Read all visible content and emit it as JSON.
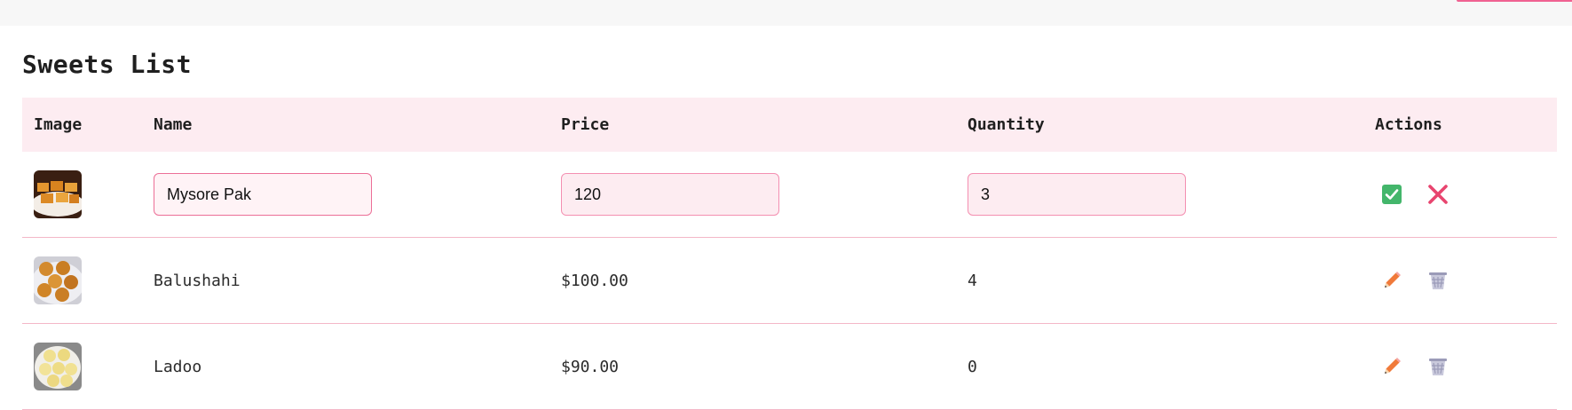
{
  "page": {
    "title": "Sweets List"
  },
  "table": {
    "headers": {
      "image": "Image",
      "name": "Name",
      "price": "Price",
      "quantity": "Quantity",
      "actions": "Actions"
    },
    "editing_row": {
      "name": "Mysore Pak",
      "price": "120",
      "quantity": "3"
    },
    "rows": [
      {
        "name": "Balushahi",
        "price": "$100.00",
        "quantity": "4"
      },
      {
        "name": "Ladoo",
        "price": "$90.00",
        "quantity": "0"
      }
    ]
  },
  "icons": {
    "save": "check-icon",
    "cancel": "close-icon",
    "edit": "pencil-icon",
    "delete": "trash-icon"
  },
  "colors": {
    "accent": "#f06292",
    "header_bg": "#fdecf1",
    "save_green": "#43b66b",
    "cancel_red": "#e8456f",
    "edit_orange": "#f07a3a",
    "trash_gray": "#9b9bb8"
  }
}
